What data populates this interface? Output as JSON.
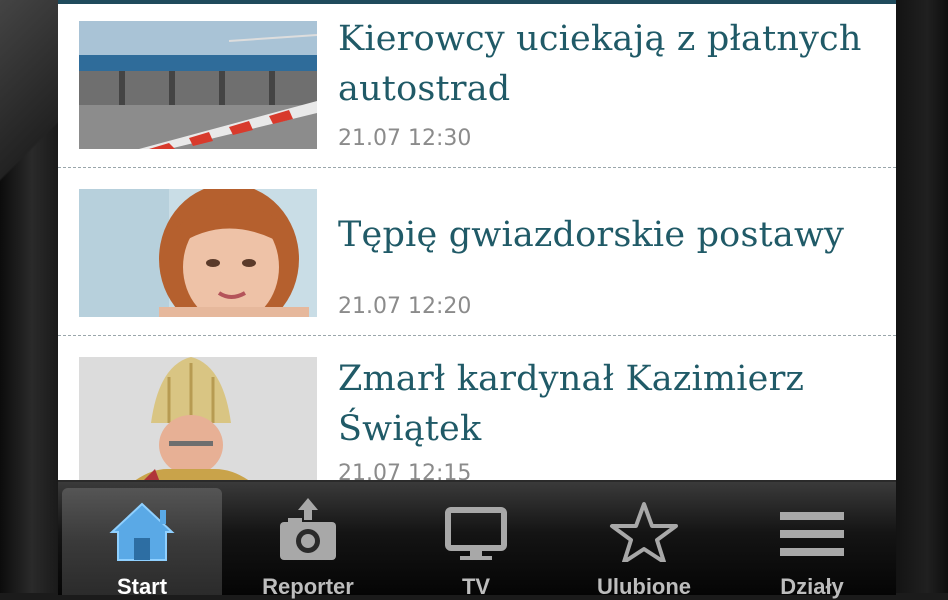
{
  "articles": [
    {
      "headline": "Kierowcy uciekają  z płatnych autostrad",
      "time": "21.07 12:30"
    },
    {
      "headline": "Tępię  gwiazdorskie postawy",
      "time": "21.07 12:20"
    },
    {
      "headline": "Zmarł kardynał Kazimierz Świątek",
      "time": "21.07 12:15"
    }
  ],
  "tabbar": {
    "tabs": [
      {
        "label": "Start",
        "icon": "home-icon",
        "active": true
      },
      {
        "label": "Reporter",
        "icon": "camera-upload-icon",
        "active": false
      },
      {
        "label": "TV",
        "icon": "tv-icon",
        "active": false
      },
      {
        "label": "Ulubione",
        "icon": "star-icon",
        "active": false
      },
      {
        "label": "Działy",
        "icon": "menu-icon",
        "active": false
      }
    ]
  },
  "colors": {
    "headline": "#205a67",
    "active_icon": "#5aa9e6",
    "tabbar": "#141414"
  }
}
